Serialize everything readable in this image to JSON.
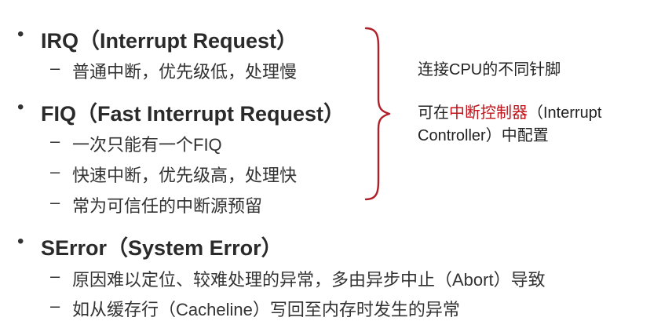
{
  "items": [
    {
      "bullet": "•",
      "title": "IRQ（Interrupt Request）",
      "subs": [
        {
          "dash": "–",
          "text": "普通中断，优先级低，处理慢"
        }
      ]
    },
    {
      "bullet": "•",
      "title": "FIQ（Fast Interrupt Request）",
      "subs": [
        {
          "dash": "–",
          "text": "一次只能有一个FIQ"
        },
        {
          "dash": "–",
          "text": "快速中断，优先级高，处理快"
        },
        {
          "dash": "–",
          "text": "常为可信任的中断源预留"
        }
      ]
    },
    {
      "bullet": "•",
      "title": "SError（System Error）",
      "subs": [
        {
          "dash": "–",
          "text": "原因难以定位、较难处理的异常，多由异步中止（Abort）导致"
        },
        {
          "dash": "–",
          "text": "如从缓存行（Cacheline）写回至内存时发生的异常"
        }
      ]
    }
  ],
  "notes": {
    "note1": "连接CPU的不同针脚",
    "note2_prefix": "可在",
    "note2_highlight": "中断控制器",
    "note2_suffix_line1": "（Interrupt",
    "note2_line2": "Controller）中配置",
    "highlight_color": "#c0141c",
    "brace_color": "#b0202a"
  }
}
